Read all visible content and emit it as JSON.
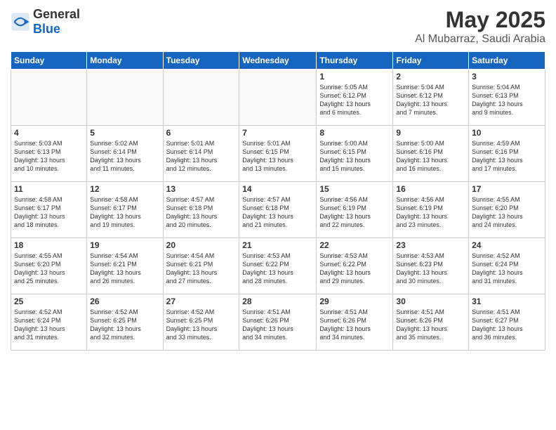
{
  "logo": {
    "general": "General",
    "blue": "Blue"
  },
  "header": {
    "month_year": "May 2025",
    "location": "Al Mubarraz, Saudi Arabia"
  },
  "weekdays": [
    "Sunday",
    "Monday",
    "Tuesday",
    "Wednesday",
    "Thursday",
    "Friday",
    "Saturday"
  ],
  "weeks": [
    [
      {
        "day": "",
        "info": ""
      },
      {
        "day": "",
        "info": ""
      },
      {
        "day": "",
        "info": ""
      },
      {
        "day": "",
        "info": ""
      },
      {
        "day": "1",
        "info": "Sunrise: 5:05 AM\nSunset: 6:12 PM\nDaylight: 13 hours\nand 6 minutes."
      },
      {
        "day": "2",
        "info": "Sunrise: 5:04 AM\nSunset: 6:12 PM\nDaylight: 13 hours\nand 7 minutes."
      },
      {
        "day": "3",
        "info": "Sunrise: 5:04 AM\nSunset: 6:13 PM\nDaylight: 13 hours\nand 9 minutes."
      }
    ],
    [
      {
        "day": "4",
        "info": "Sunrise: 5:03 AM\nSunset: 6:13 PM\nDaylight: 13 hours\nand 10 minutes."
      },
      {
        "day": "5",
        "info": "Sunrise: 5:02 AM\nSunset: 6:14 PM\nDaylight: 13 hours\nand 11 minutes."
      },
      {
        "day": "6",
        "info": "Sunrise: 5:01 AM\nSunset: 6:14 PM\nDaylight: 13 hours\nand 12 minutes."
      },
      {
        "day": "7",
        "info": "Sunrise: 5:01 AM\nSunset: 6:15 PM\nDaylight: 13 hours\nand 13 minutes."
      },
      {
        "day": "8",
        "info": "Sunrise: 5:00 AM\nSunset: 6:15 PM\nDaylight: 13 hours\nand 15 minutes."
      },
      {
        "day": "9",
        "info": "Sunrise: 5:00 AM\nSunset: 6:16 PM\nDaylight: 13 hours\nand 16 minutes."
      },
      {
        "day": "10",
        "info": "Sunrise: 4:59 AM\nSunset: 6:16 PM\nDaylight: 13 hours\nand 17 minutes."
      }
    ],
    [
      {
        "day": "11",
        "info": "Sunrise: 4:58 AM\nSunset: 6:17 PM\nDaylight: 13 hours\nand 18 minutes."
      },
      {
        "day": "12",
        "info": "Sunrise: 4:58 AM\nSunset: 6:17 PM\nDaylight: 13 hours\nand 19 minutes."
      },
      {
        "day": "13",
        "info": "Sunrise: 4:57 AM\nSunset: 6:18 PM\nDaylight: 13 hours\nand 20 minutes."
      },
      {
        "day": "14",
        "info": "Sunrise: 4:57 AM\nSunset: 6:18 PM\nDaylight: 13 hours\nand 21 minutes."
      },
      {
        "day": "15",
        "info": "Sunrise: 4:56 AM\nSunset: 6:19 PM\nDaylight: 13 hours\nand 22 minutes."
      },
      {
        "day": "16",
        "info": "Sunrise: 4:56 AM\nSunset: 6:19 PM\nDaylight: 13 hours\nand 23 minutes."
      },
      {
        "day": "17",
        "info": "Sunrise: 4:55 AM\nSunset: 6:20 PM\nDaylight: 13 hours\nand 24 minutes."
      }
    ],
    [
      {
        "day": "18",
        "info": "Sunrise: 4:55 AM\nSunset: 6:20 PM\nDaylight: 13 hours\nand 25 minutes."
      },
      {
        "day": "19",
        "info": "Sunrise: 4:54 AM\nSunset: 6:21 PM\nDaylight: 13 hours\nand 26 minutes."
      },
      {
        "day": "20",
        "info": "Sunrise: 4:54 AM\nSunset: 6:21 PM\nDaylight: 13 hours\nand 27 minutes."
      },
      {
        "day": "21",
        "info": "Sunrise: 4:53 AM\nSunset: 6:22 PM\nDaylight: 13 hours\nand 28 minutes."
      },
      {
        "day": "22",
        "info": "Sunrise: 4:53 AM\nSunset: 6:22 PM\nDaylight: 13 hours\nand 29 minutes."
      },
      {
        "day": "23",
        "info": "Sunrise: 4:53 AM\nSunset: 6:23 PM\nDaylight: 13 hours\nand 30 minutes."
      },
      {
        "day": "24",
        "info": "Sunrise: 4:52 AM\nSunset: 6:24 PM\nDaylight: 13 hours\nand 31 minutes."
      }
    ],
    [
      {
        "day": "25",
        "info": "Sunrise: 4:52 AM\nSunset: 6:24 PM\nDaylight: 13 hours\nand 31 minutes."
      },
      {
        "day": "26",
        "info": "Sunrise: 4:52 AM\nSunset: 6:25 PM\nDaylight: 13 hours\nand 32 minutes."
      },
      {
        "day": "27",
        "info": "Sunrise: 4:52 AM\nSunset: 6:25 PM\nDaylight: 13 hours\nand 33 minutes."
      },
      {
        "day": "28",
        "info": "Sunrise: 4:51 AM\nSunset: 6:26 PM\nDaylight: 13 hours\nand 34 minutes."
      },
      {
        "day": "29",
        "info": "Sunrise: 4:51 AM\nSunset: 6:26 PM\nDaylight: 13 hours\nand 34 minutes."
      },
      {
        "day": "30",
        "info": "Sunrise: 4:51 AM\nSunset: 6:26 PM\nDaylight: 13 hours\nand 35 minutes."
      },
      {
        "day": "31",
        "info": "Sunrise: 4:51 AM\nSunset: 6:27 PM\nDaylight: 13 hours\nand 36 minutes."
      }
    ]
  ]
}
